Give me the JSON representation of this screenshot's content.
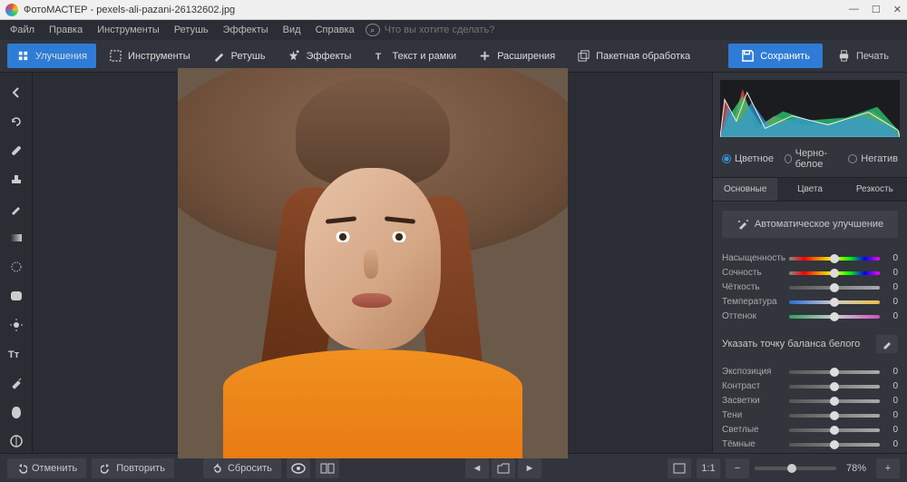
{
  "titlebar": {
    "app": "ФотоМАСТЕР",
    "file": "pexels-ali-pazani-26132602.jpg"
  },
  "menu": [
    "Файл",
    "Правка",
    "Инструменты",
    "Ретушь",
    "Эффекты",
    "Вид",
    "Справка"
  ],
  "search_placeholder": "Что вы хотите сделать?",
  "ribbon": {
    "improve": "Улучшения",
    "tools": "Инструменты",
    "retouch": "Ретушь",
    "effects": "Эффекты",
    "text": "Текст и рамки",
    "ext": "Расширения",
    "batch": "Пакетная обработка",
    "save": "Сохранить",
    "print": "Печать"
  },
  "radios": {
    "color": "Цветное",
    "bw": "Черно-белое",
    "neg": "Негатив"
  },
  "tabs": {
    "basic": "Основные",
    "colors": "Цвета",
    "sharp": "Резкость"
  },
  "auto": "Автоматическое улучшение",
  "sliders1": [
    {
      "label": "Насыщенность",
      "val": "0",
      "grad": "linear-gradient(90deg,#888,#f00,#ff8c00,#ff0,#0f0,#00f,#f0f)"
    },
    {
      "label": "Сочность",
      "val": "0",
      "grad": "linear-gradient(90deg,#888,#f00,#ff8c00,#ff0,#0f0,#00f,#f0f)"
    },
    {
      "label": "Чёткость",
      "val": "0",
      "grad": "gray"
    },
    {
      "label": "Температура",
      "val": "0",
      "grad": "linear-gradient(90deg,#2a6bd4,#ccc,#e8c040)"
    },
    {
      "label": "Оттенок",
      "val": "0",
      "grad": "linear-gradient(90deg,#2ea060,#ccc,#d050c0)"
    }
  ],
  "wb": "Указать точку баланса белого",
  "sliders2": [
    {
      "label": "Экспозиция",
      "val": "0"
    },
    {
      "label": "Контраст",
      "val": "0"
    },
    {
      "label": "Засветки",
      "val": "0"
    },
    {
      "label": "Тени",
      "val": "0"
    },
    {
      "label": "Светлые",
      "val": "0"
    },
    {
      "label": "Тёмные",
      "val": "0"
    }
  ],
  "footer": {
    "undo": "Отменить",
    "redo": "Повторить",
    "reset": "Сбросить",
    "ratio": "1:1",
    "zoom": "78%"
  }
}
